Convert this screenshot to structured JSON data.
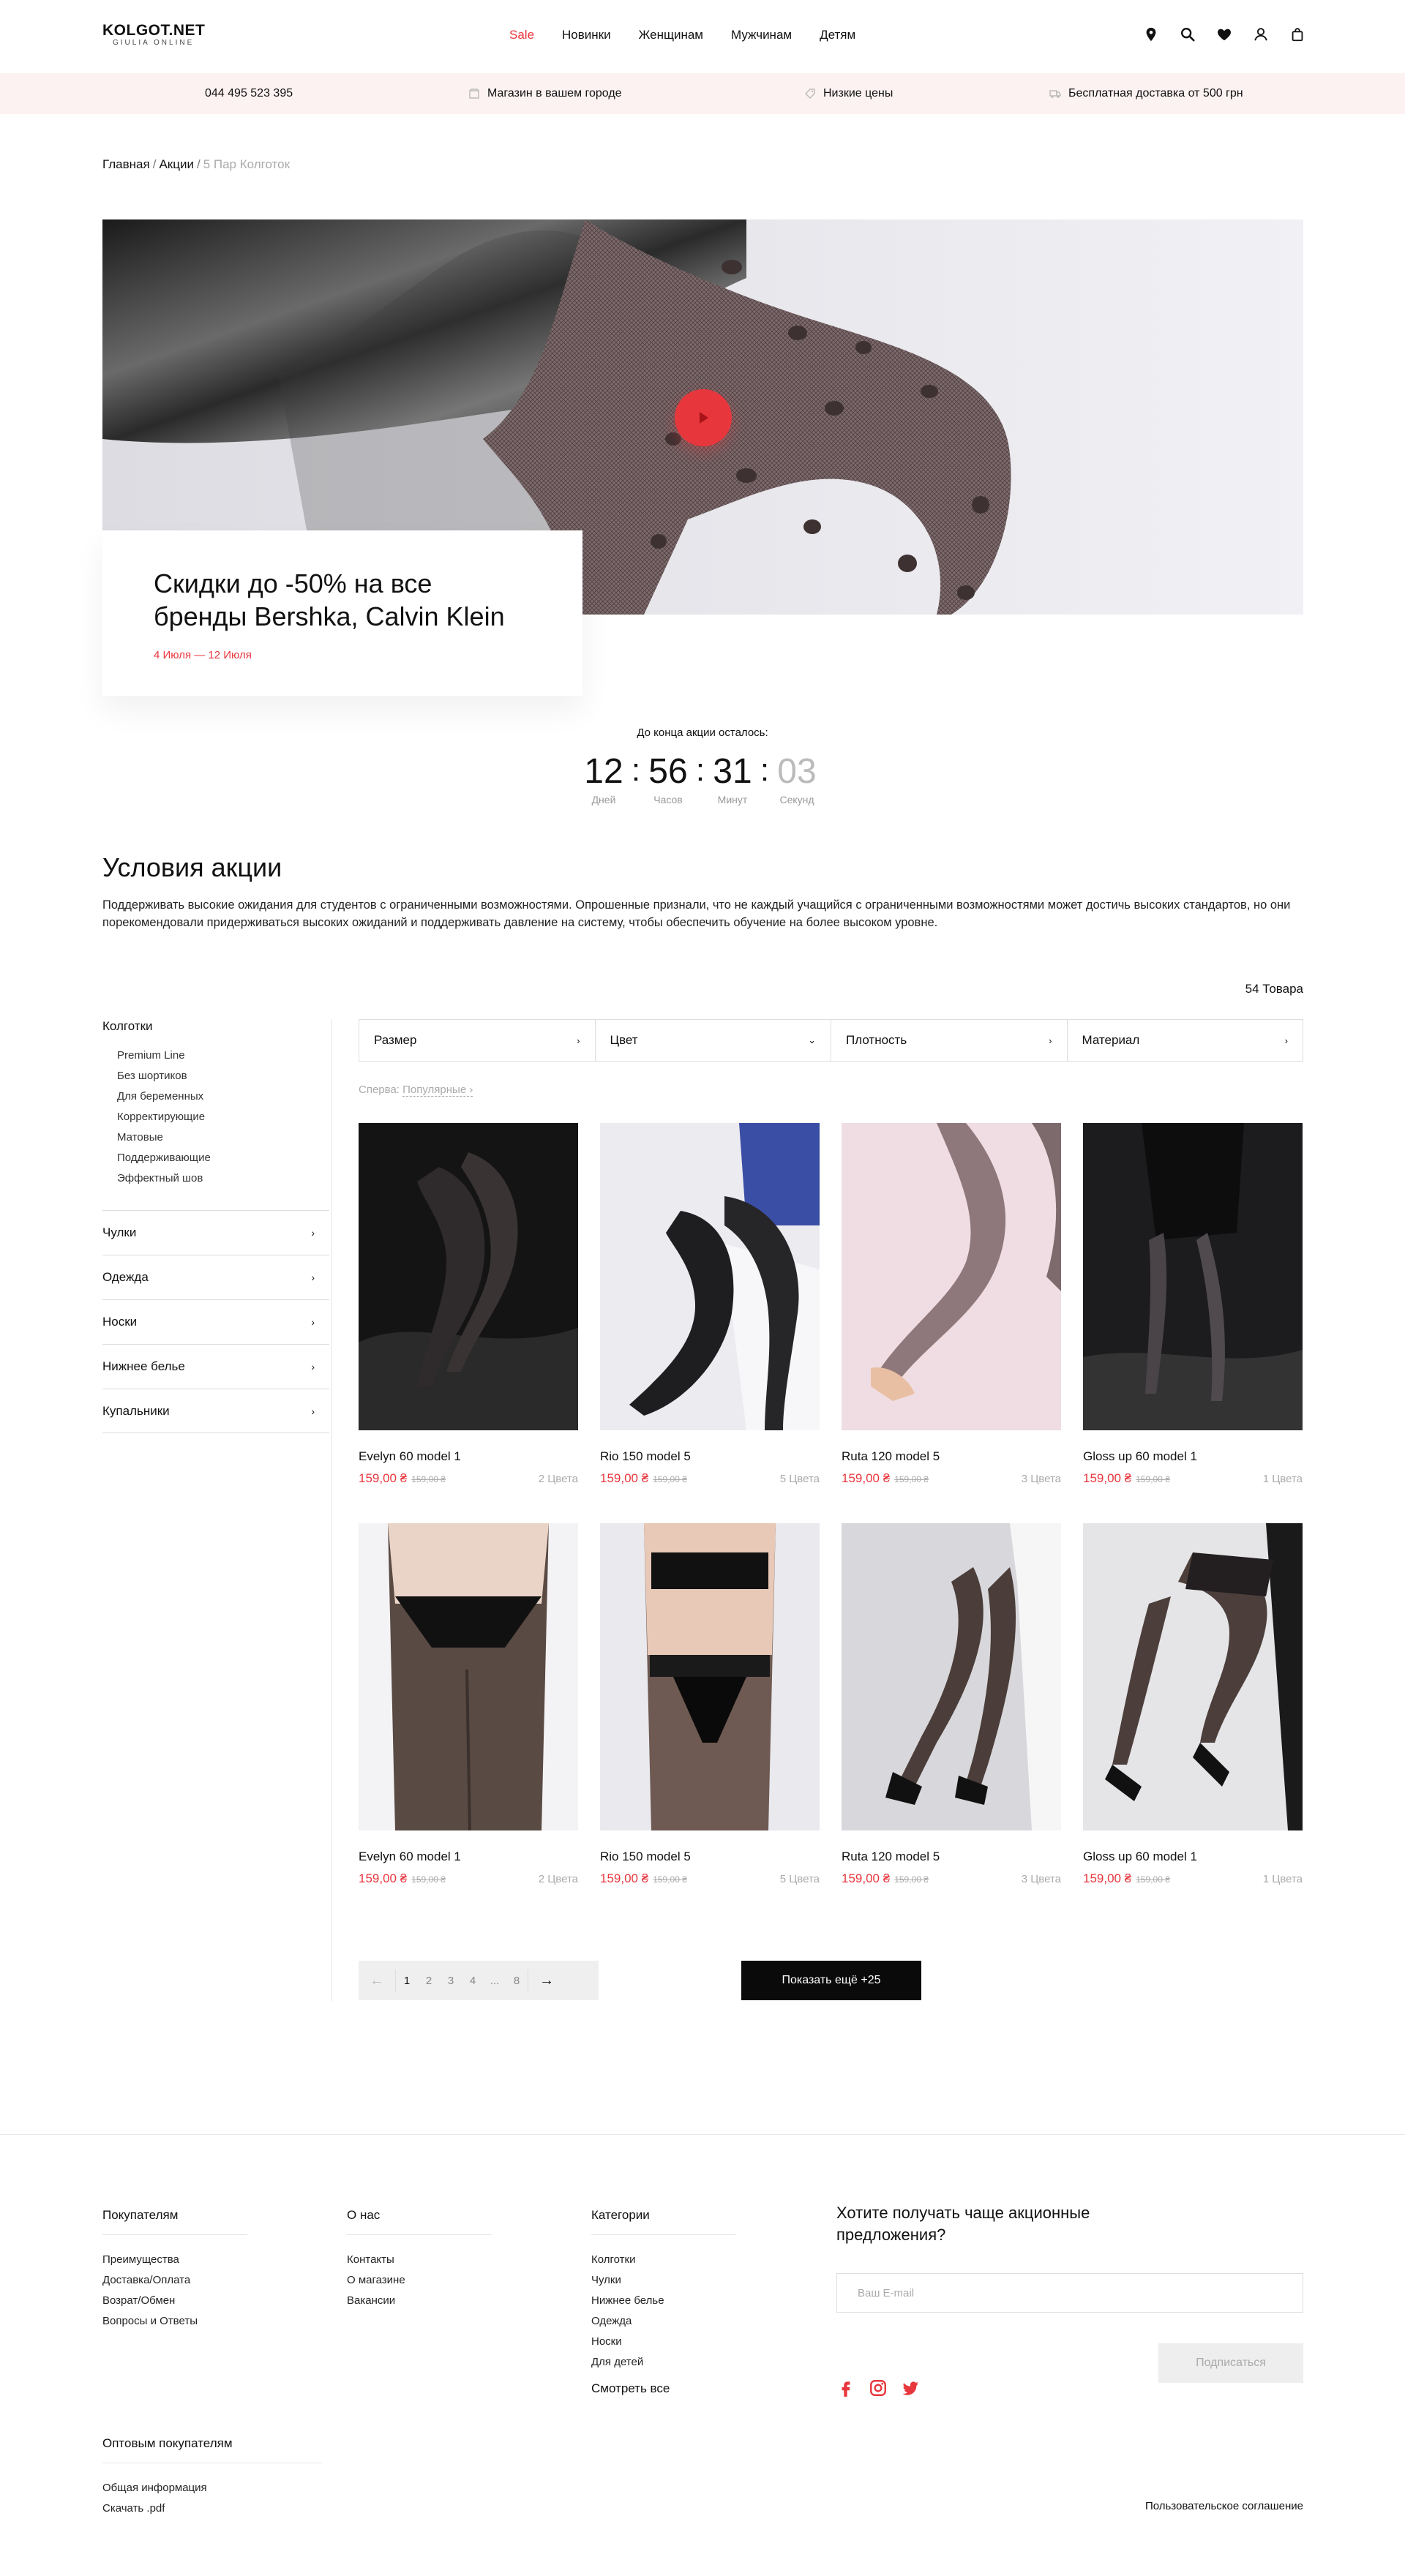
{
  "header": {
    "logo_main": "KOLGOT.NET",
    "logo_sub": "GIULIA ONLINE",
    "nav": [
      "Sale",
      "Новинки",
      "Женщинам",
      "Мужчинам",
      "Детям"
    ],
    "icons": [
      "location-icon",
      "search-icon",
      "heart-icon",
      "user-icon",
      "bag-icon"
    ]
  },
  "infobar": {
    "phone": "044 495 523 395",
    "store": "Магазин в вашем городе",
    "prices": "Низкие цены",
    "delivery": "Бесплатная доставка от 500 грн"
  },
  "breadcrumb": {
    "home": "Главная",
    "sep": "/",
    "promos": "Акции",
    "current": "5 Пар Колготок"
  },
  "hero": {
    "title": "Скидки до -50% на все бренды Bershka, Calvin Klein",
    "dates": "4 Июля — 12 Июля"
  },
  "countdown": {
    "title": "До конца акции осталось:",
    "days": "12",
    "days_label": "Дней",
    "hours": "56",
    "hours_label": "Часов",
    "minutes": "31",
    "minutes_label": "Минут",
    "seconds": "03",
    "seconds_label": "Секунд",
    "sep": ":"
  },
  "terms": {
    "title": "Условия акции",
    "text": "Поддерживать высокие ожидания для студентов с ограниченными возможностями. Опрошенные признали, что не каждый учащийся с ограниченными возможностями может достичь высоких стандартов, но они порекомендовали придерживаться высоких ожиданий и поддерживать давление на систему, чтобы обеспечить обучение на более высоком уровне."
  },
  "catalog": {
    "count": "54 Товара",
    "sidebar": {
      "head": "Колготки",
      "subs": [
        "Premium Line",
        "Без шортиков",
        "Для беременных",
        "Корректирующие",
        "Матовые",
        "Поддерживающие",
        "Эффектный шов"
      ],
      "cats": [
        "Чулки",
        "Одежда",
        "Носки",
        "Нижнее белье",
        "Купальники"
      ],
      "chev": "›"
    },
    "filters": [
      {
        "label": "Размер",
        "chev": "›"
      },
      {
        "label": "Цвет",
        "chev": "⌄"
      },
      {
        "label": "Плотность",
        "chev": "›"
      },
      {
        "label": "Материал",
        "chev": "›"
      }
    ],
    "sort_label": "Сперва:",
    "sort_value": "Популярные ›",
    "products": [
      {
        "name": "Evelyn 60 model 1",
        "price": "159,00 ₴",
        "old": "159,00 ₴",
        "colors": "2 Цвета"
      },
      {
        "name": "Rio 150 model 5",
        "price": "159,00 ₴",
        "old": "159,00 ₴",
        "colors": "5 Цвета"
      },
      {
        "name": "Ruta 120 model 5",
        "price": "159,00 ₴",
        "old": "159,00 ₴",
        "colors": "3 Цвета"
      },
      {
        "name": "Gloss up 60 model 1",
        "price": "159,00 ₴",
        "old": "159,00 ₴",
        "colors": "1 Цвета"
      },
      {
        "name": "Evelyn 60 model 1",
        "price": "159,00 ₴",
        "old": "159,00 ₴",
        "colors": "2 Цвета"
      },
      {
        "name": "Rio 150 model 5",
        "price": "159,00 ₴",
        "old": "159,00 ₴",
        "colors": "5 Цвета"
      },
      {
        "name": "Ruta 120 model 5",
        "price": "159,00 ₴",
        "old": "159,00 ₴",
        "colors": "3 Цвета"
      },
      {
        "name": "Gloss up 60 model 1",
        "price": "159,00 ₴",
        "old": "159,00 ₴",
        "colors": "1 Цвета"
      }
    ],
    "pager": {
      "prev": "←",
      "pages": [
        "1",
        "2",
        "3",
        "4",
        "...",
        "8"
      ],
      "next": "→"
    },
    "more_btn": "Показать ещё +25"
  },
  "footer": {
    "buyers": {
      "title": "Покупателям",
      "links": [
        "Преимущества",
        "Доставка/Оплата",
        "Возрат/Обмен",
        "Вопросы и Ответы"
      ]
    },
    "about": {
      "title": "О нас",
      "links": [
        "Контакты",
        "О магазине",
        "Вакансии"
      ]
    },
    "categories": {
      "title": "Категории",
      "links": [
        "Колготки",
        "Чулки",
        "Нижнее белье",
        "Одежда",
        "Носки",
        "Для детей"
      ],
      "all": "Смотреть все"
    },
    "wholesale": {
      "title": "Оптовым покупателям",
      "links": [
        "Общая информация",
        "Скачать .pdf"
      ]
    },
    "subscribe_title": "Хотите получать чаще акционные предложения?",
    "email_placeholder": "Ваш E-mail",
    "subscribe_btn": "Подписаться",
    "social": [
      "facebook-icon",
      "instagram-icon",
      "twitter-icon"
    ],
    "agreement": "Пользовательское соглашение"
  },
  "colors": {
    "accent": "#e8363d",
    "infobar_bg": "#fdf2f2",
    "dark": "#0a0a0a"
  }
}
